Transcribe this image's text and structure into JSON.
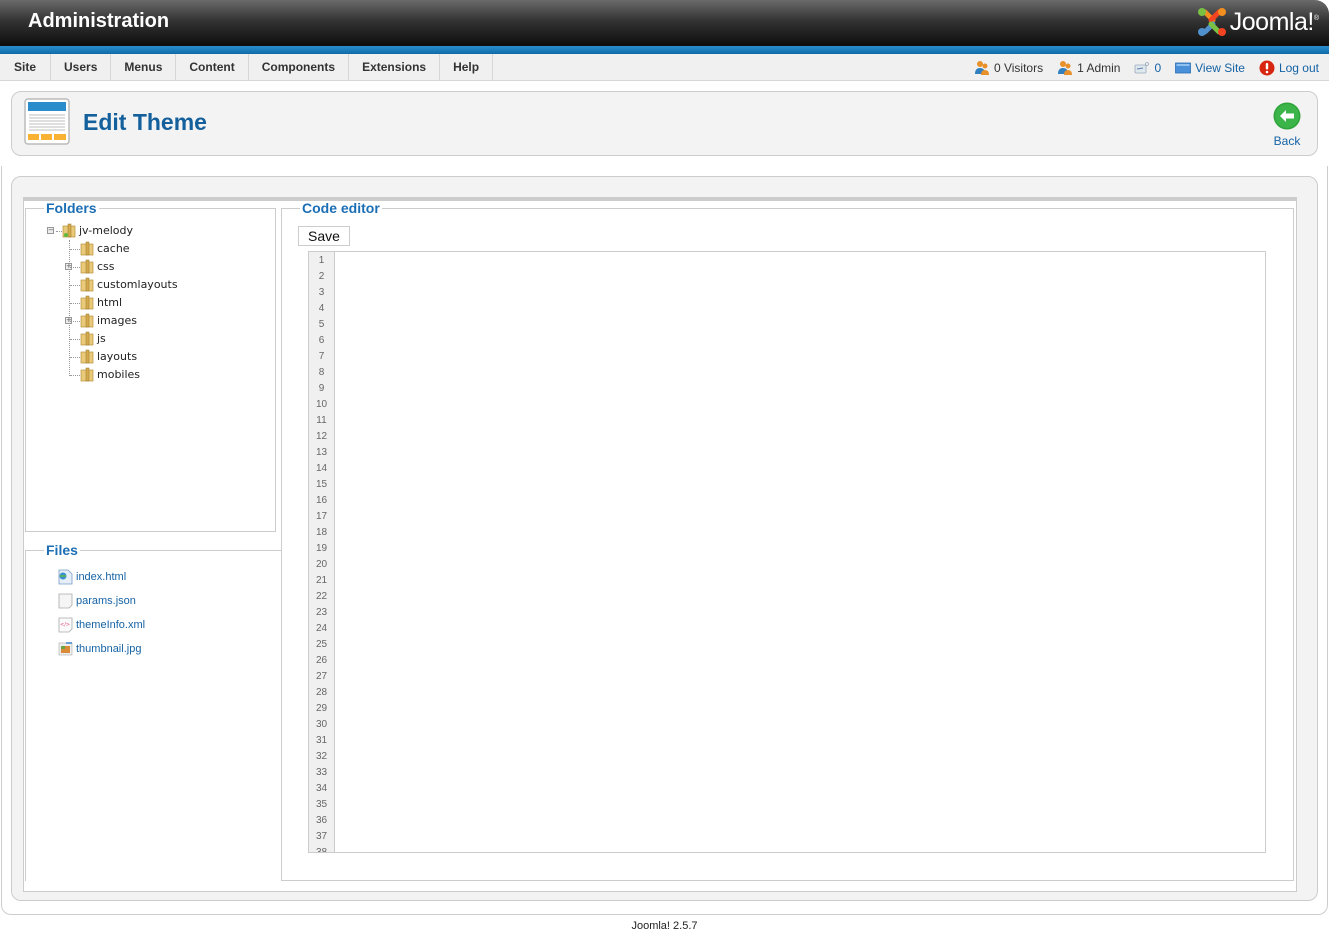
{
  "header": {
    "title": "Administration",
    "logo_text": "Joomla!",
    "logo_tm": "®"
  },
  "menu": [
    {
      "label": "Site"
    },
    {
      "label": "Users"
    },
    {
      "label": "Menus"
    },
    {
      "label": "Content"
    },
    {
      "label": "Components"
    },
    {
      "label": "Extensions"
    },
    {
      "label": "Help"
    }
  ],
  "status": {
    "visitors": "0 Visitors",
    "admins": "1 Admin",
    "messages": "0",
    "view_site": "View Site",
    "logout": "Log out"
  },
  "toolbar": {
    "page_title": "Edit Theme",
    "back_label": "Back"
  },
  "folders": {
    "legend": "Folders",
    "root": "jv-melody",
    "children": [
      {
        "name": "cache",
        "expandable": false
      },
      {
        "name": "css",
        "expandable": true
      },
      {
        "name": "customlayouts",
        "expandable": false
      },
      {
        "name": "html",
        "expandable": false
      },
      {
        "name": "images",
        "expandable": true
      },
      {
        "name": "js",
        "expandable": false
      },
      {
        "name": "layouts",
        "expandable": false
      },
      {
        "name": "mobiles",
        "expandable": false
      }
    ]
  },
  "files": {
    "legend": "Files",
    "items": [
      {
        "name": "index.html",
        "icon": "html-file-icon"
      },
      {
        "name": "params.json",
        "icon": "blank-file-icon"
      },
      {
        "name": "themeInfo.xml",
        "icon": "xml-file-icon"
      },
      {
        "name": "thumbnail.jpg",
        "icon": "image-file-icon"
      }
    ]
  },
  "editor": {
    "legend": "Code editor",
    "save_label": "Save",
    "line_count": 38,
    "content": ""
  },
  "footer": {
    "version": "Joomla! 2.5.7"
  },
  "colors": {
    "accent_blue": "#14609c",
    "link_blue": "#1563a5",
    "header_bar_blue": "#1a7bbd"
  }
}
